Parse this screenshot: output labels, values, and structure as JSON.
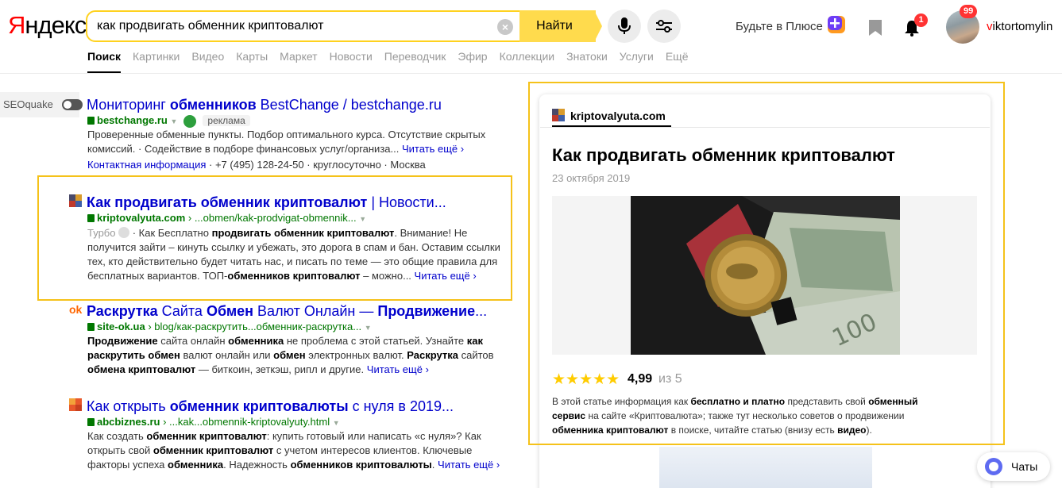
{
  "header": {
    "logo_first": "Я",
    "logo_rest": "ндекс",
    "search_value": "как продвигать обменник криптовалют",
    "search_button": "Найти",
    "plus_text": "Будьте в Плюсе",
    "bell_count": "1",
    "avatar_count": "99",
    "username_first": "v",
    "username_rest": "iktortomylin"
  },
  "nav": {
    "items": [
      "Поиск",
      "Картинки",
      "Видео",
      "Карты",
      "Маркет",
      "Новости",
      "Переводчик",
      "Эфир",
      "Коллекции",
      "Знатоки",
      "Услуги",
      "Ещё"
    ]
  },
  "seoquake": {
    "label": "SEOquake"
  },
  "results": [
    {
      "title_pre": "Мониторинг ",
      "title_b": "обменников",
      "title_post": " BestChange / bestchange.ru",
      "url_b": "bestchange.ru",
      "ad": "реклама",
      "snippet1": "Проверенные обменные пункты. Подбор оптимального курса. Отсутствие скрытых",
      "snippet2": "комиссий. · Содействие в подборе финансовых услуг/организа...",
      "more": "Читать ещё ›",
      "contact": "Контактная информация",
      "phone": "+7 (495) 128-24-50",
      "hours": "круглосуточно",
      "city": "Москва"
    },
    {
      "title_b": "Как продвигать обменник криптовалют",
      "title_post": " | Новости...",
      "url_b": "kriptovalyuta.com",
      "url_path": "› ...obmen/kak-prodvigat-obmennik...",
      "turbo": "Турбо",
      "s1_pre": "· Как Бесплатно ",
      "s1_b": "продвигать обменник криптовалют",
      "s1_post": ". Внимание! Не",
      "s2": "получится зайти – кинуть ссылку и убежать, это дорога в спам и бан. Оставим ссылки",
      "s3": "тех, кто действительно будет читать нас, и писать по теме — это общие правила для",
      "s4_pre": "бесплатных вариантов. ТОП-",
      "s4_b": "обменников криптовалют",
      "s4_post": " – можно...",
      "more": "Читать ещё ›"
    },
    {
      "fav": "ok",
      "t_b1": "Раскрутка",
      "t_1": " Сайта ",
      "t_b2": "Обмен",
      "t_2": " Валют Онлайн — ",
      "t_b3": "Продвижение",
      "t_3": "...",
      "url_b": "site-ok.ua",
      "url_path": "› blog/как-раскрутить...обменник-раскрутка...",
      "s1_b": "Продвижение",
      "s1_1": " сайта онлайн ",
      "s1_b2": "обменника",
      "s1_2": " не проблема с этой статьей. Узнайте ",
      "s1_b3": "как",
      "s2_b": "раскрутить обмен",
      "s2_1": " валют онлайн или ",
      "s2_b2": "обмен",
      "s2_2": " электронных валют. ",
      "s2_b3": "Раскрутка",
      "s2_3": " сайтов",
      "s3_b": "обмена криптовалют",
      "s3_1": " — биткоин, зеткэш, рипл и другие.",
      "more": "Читать ещё ›"
    },
    {
      "t_1": "Как открыть ",
      "t_b": "обменник криптовалюты",
      "t_2": " с нуля в 2019...",
      "url_b": "abcbiznes.ru",
      "url_path": "› ...kak...obmennik-kriptovalyuty.html",
      "s1_1": "Как создать ",
      "s1_b": "обменник криптовалют",
      "s1_2": ": купить готовый или написать «с нуля»? Как",
      "s2_1": "открыть свой ",
      "s2_b": "обменник криптовалют",
      "s2_2": " с учетом интересов клиентов. Ключевые",
      "s3_1": "факторы успеха ",
      "s3_b": "обменника",
      "s3_2": ". Надежность ",
      "s3_b2": "обменников криптовалюты",
      "s3_3": ".",
      "more": "Читать ещё ›"
    }
  ],
  "card": {
    "site": "kriptovalyuta.com",
    "title": "Как продвигать обменник криптовалют",
    "date": "23 октября 2019",
    "stars": "★★★★★",
    "rating": "4,99",
    "rating_of": "из 5",
    "d1_1": "В этой статье информация как ",
    "d1_b": "бесплатно и платно",
    "d1_2": " представить свой ",
    "d1_b2": "обменный",
    "d2_b": "сервис",
    "d2_1": " на сайте «Криптовалюта»; также тут несколько советов о продвижении",
    "d3_b": "обменника криптовалют",
    "d3_1": " в поиске, читайте статью (внизу есть ",
    "d3_b2": "видео",
    "d3_2": ")."
  },
  "chats": {
    "label": "Чаты"
  },
  "colors": {
    "accent": "#ffdb4d",
    "highlight": "#f5c21a",
    "link": "#0000cc",
    "url": "#007700"
  }
}
